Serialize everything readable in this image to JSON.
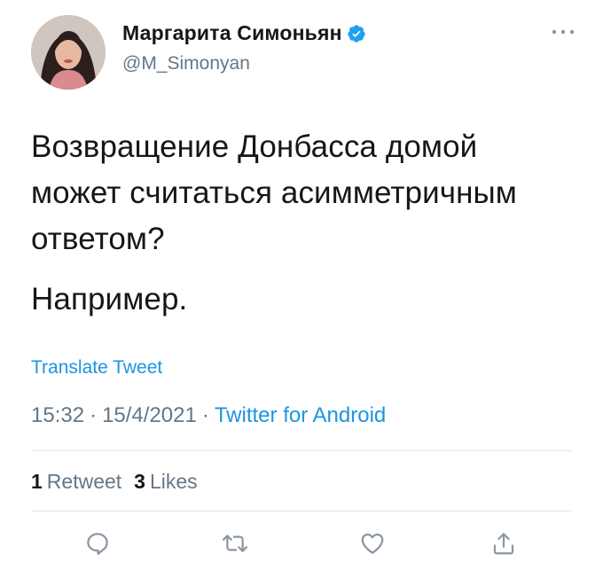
{
  "user": {
    "display_name": "Маргарита Симоньян",
    "handle": "@M_Simonyan",
    "verified": true
  },
  "tweet": {
    "paragraphs": [
      "Возвращение Донбасса домой может считаться асимметричным ответом?",
      "Например."
    ],
    "translate_label": "Translate Tweet",
    "time": "15:32",
    "date": "15/4/2021",
    "separator": "·",
    "source": "Twitter for Android"
  },
  "stats": {
    "retweets_count": "1",
    "retweets_label": "Retweet",
    "likes_count": "3",
    "likes_label": "Likes"
  },
  "icons": {
    "verified": "verified-badge-icon",
    "more": "more-icon",
    "reply": "reply-icon",
    "retweet": "retweet-icon",
    "like": "like-icon",
    "share": "share-icon"
  },
  "colors": {
    "accent": "#1b95e0",
    "secondary_text": "#657786",
    "icon_gray": "#8a96a3",
    "divider": "#e1e8ed"
  }
}
